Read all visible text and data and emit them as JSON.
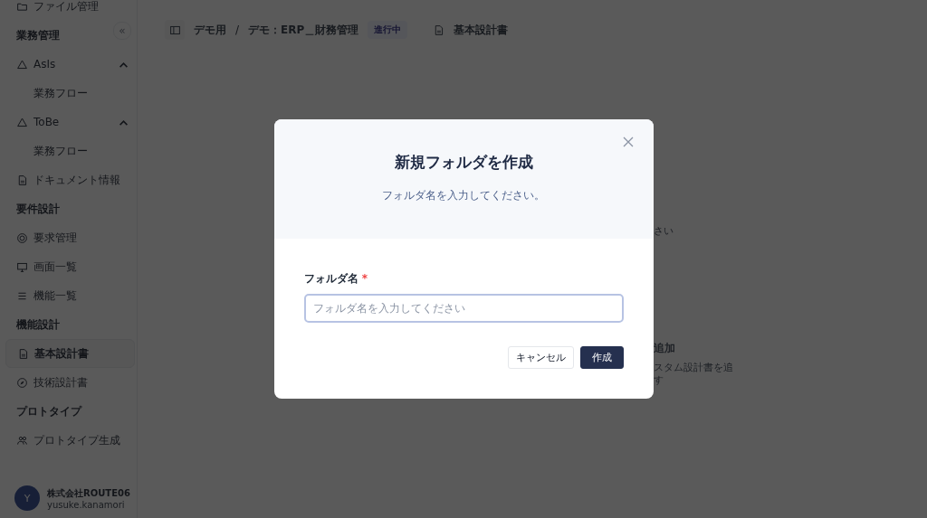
{
  "sidebar": {
    "collapse_icon": "«",
    "groups": [
      {
        "items": [
          {
            "label": "ファイル管理",
            "selected": false
          }
        ]
      },
      {
        "heading": "業務管理",
        "items": [
          {
            "label": "AsIs",
            "selected": false,
            "expanded": true,
            "children": [
              {
                "label": "業務フロー",
                "selected": false
              }
            ]
          },
          {
            "label": "ToBe",
            "selected": false,
            "expanded": true,
            "children": [
              {
                "label": "業務フロー",
                "selected": false
              }
            ]
          },
          {
            "label": "ドキュメント情報",
            "selected": false
          }
        ]
      },
      {
        "heading": "要件設計",
        "items": [
          {
            "label": "要求管理",
            "selected": false
          },
          {
            "label": "画面一覧",
            "selected": false
          },
          {
            "label": "機能一覧",
            "selected": false
          }
        ]
      },
      {
        "heading": "機能設計",
        "items": [
          {
            "label": "基本設計書",
            "selected": true
          },
          {
            "label": "技術設計書",
            "selected": false
          }
        ]
      },
      {
        "heading": "プロトタイプ",
        "items": [
          {
            "label": "プロトタイプ生成",
            "selected": false
          }
        ]
      }
    ],
    "user": {
      "avatar": "Y",
      "company": "株式会社ROUTE06",
      "email": "yusuke.kanamori"
    }
  },
  "header": {
    "breadcrumb": [
      "デモ用",
      "デモ：ERP＿財務管理"
    ],
    "breadcrumb_separator": "/",
    "status_badge": "進行中",
    "page_title": "基本設計書"
  },
  "background_fragments": [
    {
      "text": "さい",
      "kind": "plain"
    },
    {
      "text": "追加",
      "kind": "bold"
    },
    {
      "text": "スタム設計書を追",
      "kind": "plain"
    },
    {
      "text": "す",
      "kind": "plain"
    }
  ],
  "dialog": {
    "title": "新規フォルダを作成",
    "subtitle": "フォルダ名を入力してください。",
    "field": {
      "label": "フォルダ名",
      "required_mark": "*",
      "placeholder": "フォルダ名を入力してください"
    },
    "buttons": [
      {
        "label": "キャンセル",
        "kind": "secondary"
      },
      {
        "label": "作成",
        "kind": "primary"
      }
    ]
  }
}
